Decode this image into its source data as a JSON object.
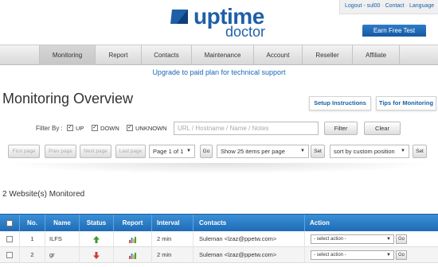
{
  "logo": {
    "word1": "uptime",
    "word2": "doctor",
    "brand_color": "#1e5fa8"
  },
  "toplinks": {
    "user": "Logout - sul00",
    "contact": "Contact",
    "language": "Language",
    "sep": "·"
  },
  "earn_button": "Earn Free Test",
  "nav": [
    "Monitoring",
    "Report",
    "Contacts",
    "Maintenance",
    "Account",
    "Reseller",
    "Affiliate"
  ],
  "upgrade_text": "Upgrade to paid plan for technical support",
  "page_title": "Monitoring Overview",
  "buttons": {
    "setup": "Setup Instructions",
    "tips": "Tips for Monitoring"
  },
  "filter": {
    "label": "Filter By :",
    "up": "UP",
    "down": "DOWN",
    "unknown": "UNKNOWN",
    "check_mark": "✓",
    "placeholder": "URL / Hostname / Name / Notes",
    "filter_btn": "Filter",
    "clear_btn": "Clear"
  },
  "paging": {
    "first": "First page",
    "prev": "Prev page",
    "next": "Next page",
    "last": "Last page",
    "page_select": "Page 1 of 1",
    "go": "Go",
    "per_page": "Show 25 items per page",
    "set": "Set",
    "sort": "sort by custom position",
    "arrow": "▼"
  },
  "monitored_count": "2 Website(s) Monitored",
  "table": {
    "headers": [
      "",
      "No.",
      "Name",
      "Status",
      "Report",
      "Interval",
      "Contacts",
      "Action"
    ],
    "rows": [
      {
        "no": "1",
        "name": "ILFS",
        "status": "up",
        "interval": "2 min",
        "contacts": "Suleman <lzaz@ppetw.com>",
        "action": "- select action -",
        "go": "Go"
      },
      {
        "no": "2",
        "name": "gr",
        "status": "down",
        "interval": "2 min",
        "contacts": "Suleman <lzaz@ppetw.com>",
        "action": "- select action -",
        "go": "Go"
      }
    ]
  },
  "colors": {
    "header_blue": "#2a7dc8",
    "up": "#3a9a2a",
    "down": "#d33a3a"
  }
}
